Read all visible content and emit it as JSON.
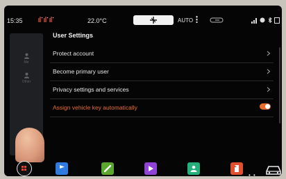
{
  "status_bar": {
    "time": "15:35",
    "temperature": "22.0°C",
    "climate_mode": "AUTO",
    "icons": [
      "seat-heat-icon",
      "fan-icon",
      "recirculation-icon",
      "signal-icon",
      "wifi-icon",
      "bluetooth-icon",
      "battery-icon"
    ]
  },
  "side_panel": {
    "items": [
      {
        "icon": "user-icon",
        "label": "Me"
      },
      {
        "icon": "user-icon",
        "label": "Other"
      }
    ]
  },
  "settings": {
    "title": "User Settings",
    "rows": [
      {
        "label": "Protect account",
        "control": "chevron"
      },
      {
        "label": "Become primary user",
        "control": "chevron"
      },
      {
        "label": "Privacy settings and services",
        "control": "chevron"
      },
      {
        "label": "Assign vehicle key automatically",
        "control": "toggle",
        "toggle_on": true
      }
    ]
  },
  "dock": {
    "apps": [
      {
        "name": "apps-grid",
        "color": "#e8402b"
      },
      {
        "name": "navigation",
        "color": "#2f7be0"
      },
      {
        "name": "phone",
        "color": "#5aa62e"
      },
      {
        "name": "media",
        "color": "#8e43d6"
      },
      {
        "name": "contacts",
        "color": "#23b07a"
      },
      {
        "name": "files",
        "color": "#e0502f"
      },
      {
        "name": "vehicle",
        "color": "#e8e8e8"
      }
    ],
    "more": "• •"
  },
  "colors": {
    "accent": "#e86d2c",
    "background": "#050505",
    "panel": "#1f2023"
  }
}
